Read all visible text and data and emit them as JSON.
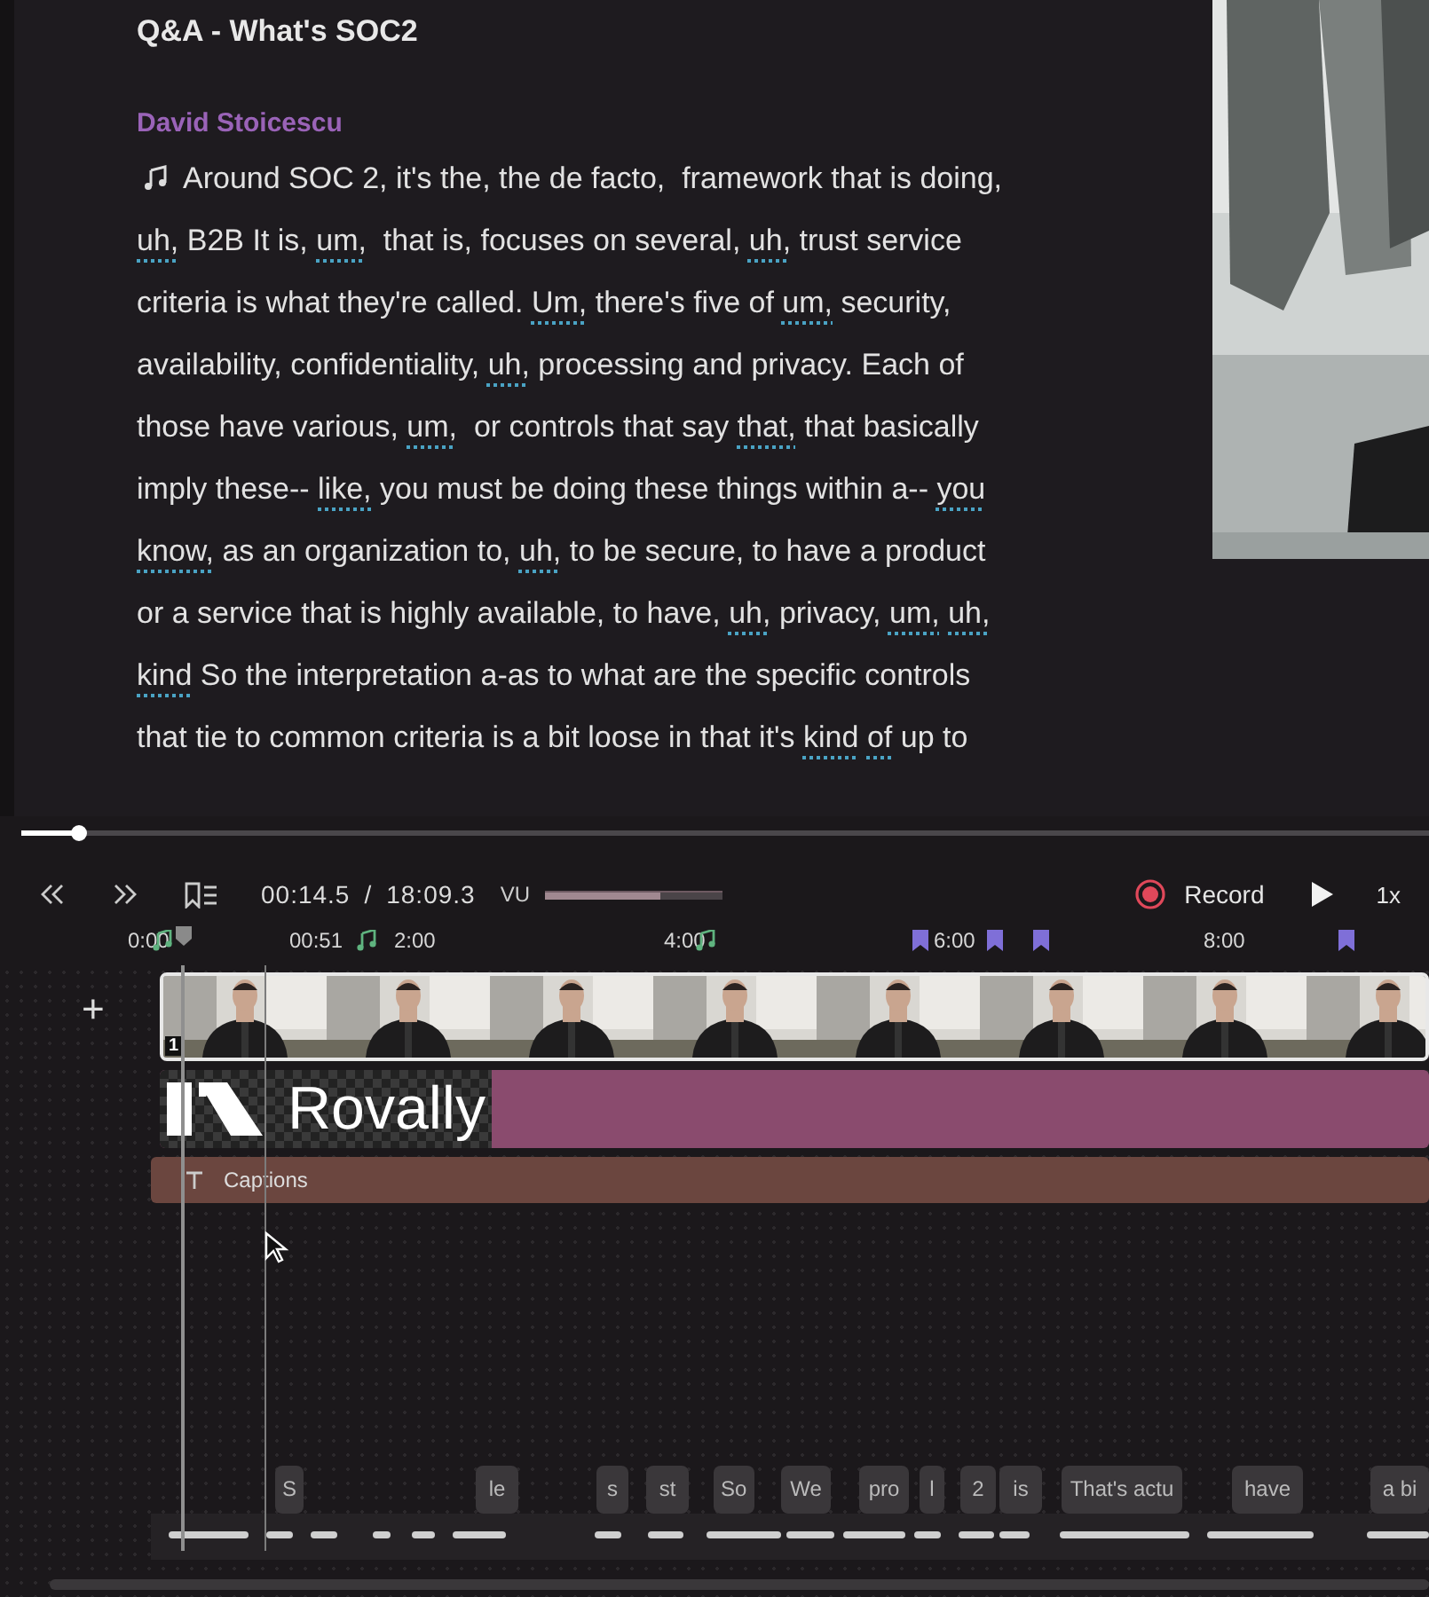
{
  "document": {
    "title": "Q&A - What's SOC2",
    "speaker": "David Stoicescu",
    "lines": [
      [
        {
          "text": "Around SOC 2, it's the, the de facto,  framework that is doing,",
          "filler": false
        }
      ],
      [
        {
          "text": "uh,",
          "filler": true
        },
        {
          "text": " B2B It is, ",
          "filler": false
        },
        {
          "text": "um,",
          "filler": true
        },
        {
          "text": "  that is, focuses on several, ",
          "filler": false
        },
        {
          "text": "uh,",
          "filler": true
        },
        {
          "text": " trust service",
          "filler": false
        }
      ],
      [
        {
          "text": "criteria is what they're called. ",
          "filler": false
        },
        {
          "text": "Um,",
          "filler": true
        },
        {
          "text": " there's five of ",
          "filler": false
        },
        {
          "text": "um,",
          "filler": true
        },
        {
          "text": " security,",
          "filler": false
        }
      ],
      [
        {
          "text": "availability, confidentiality, ",
          "filler": false
        },
        {
          "text": "uh,",
          "filler": true
        },
        {
          "text": " processing and privacy. Each of",
          "filler": false
        }
      ],
      [
        {
          "text": "those have various, ",
          "filler": false
        },
        {
          "text": "um,",
          "filler": true
        },
        {
          "text": "  or controls that say ",
          "filler": false
        },
        {
          "text": "that,",
          "filler": true
        },
        {
          "text": " that basically",
          "filler": false
        }
      ],
      [
        {
          "text": "imply these-- ",
          "filler": false
        },
        {
          "text": "like,",
          "filler": true
        },
        {
          "text": " you must be doing these things within a-- ",
          "filler": false
        },
        {
          "text": "you",
          "filler": true
        }
      ],
      [
        {
          "text": "know,",
          "filler": true
        },
        {
          "text": " as an organization to, ",
          "filler": false
        },
        {
          "text": "uh,",
          "filler": true
        },
        {
          "text": " to be secure, to have a product",
          "filler": false
        }
      ],
      [
        {
          "text": "or a service that is highly available, to have, ",
          "filler": false
        },
        {
          "text": "uh,",
          "filler": true
        },
        {
          "text": " privacy, ",
          "filler": false
        },
        {
          "text": "um,",
          "filler": true
        },
        {
          "text": "uh,",
          "filler": true
        }
      ],
      [
        {
          "text": "kind",
          "filler": true
        },
        {
          "text": " So the interpretation a-as to what are the specific controls",
          "filler": false
        }
      ],
      [
        {
          "text": "that tie to common criteria is a bit loose in that it's ",
          "filler": false
        },
        {
          "text": "kind",
          "filler": true
        },
        {
          "text": "of",
          "filler": true
        },
        {
          "text": " up to",
          "filler": false
        }
      ]
    ]
  },
  "scrubber": {
    "level": 0.04
  },
  "toolbar": {
    "current_time": "00:14.5",
    "separator": "/",
    "duration": "18:09.3",
    "vu_meter": {
      "label": "VU",
      "level": 0.65
    },
    "record_label": "Record",
    "speed": "1x"
  },
  "ruler": {
    "labels": [
      "0:00",
      "00:51",
      "2:00",
      "4:00",
      "6:00",
      "8:00"
    ],
    "markers": [
      {
        "kind": "music"
      },
      {
        "kind": "music"
      },
      {
        "kind": "music"
      },
      {
        "kind": "bookmark"
      },
      {
        "kind": "bookmark"
      },
      {
        "kind": "bookmark"
      },
      {
        "kind": "bookmark"
      }
    ]
  },
  "tracks": {
    "add_button": "+",
    "video": {
      "badge": "1"
    },
    "logo": {
      "text": "Rovally"
    },
    "captions": {
      "label": "Captions"
    },
    "words": [
      "S",
      "le",
      "s",
      "st",
      "So",
      "We",
      "pro",
      "l",
      "2",
      "is",
      "That's actu",
      "have",
      "a bi"
    ]
  }
}
